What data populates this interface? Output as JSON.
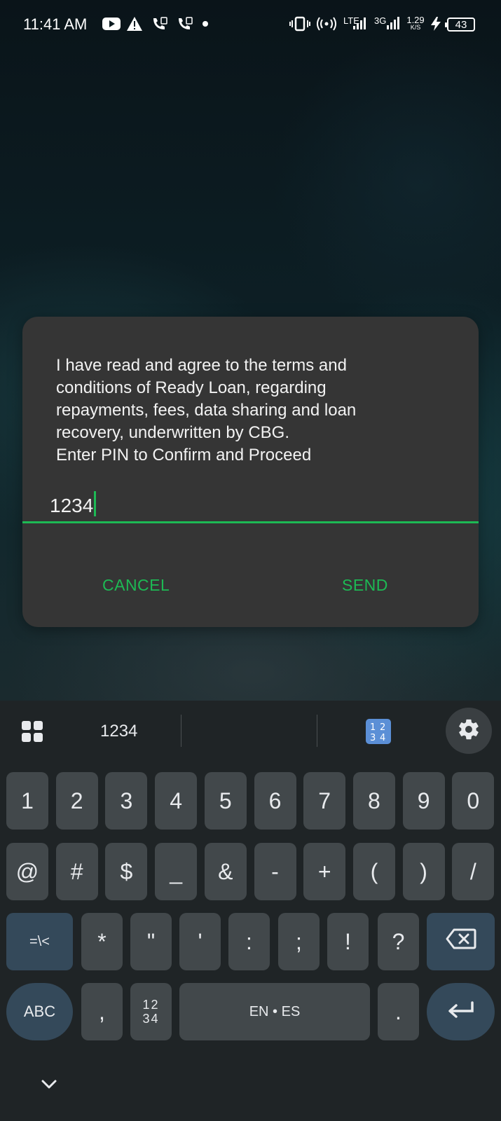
{
  "status_bar": {
    "time": "11:41 AM",
    "network_speed": "1.29",
    "network_speed_unit": "K/S",
    "lte_label": "LTE",
    "g3_label": "3G",
    "battery": "43"
  },
  "dialog": {
    "message": "I have read and agree to the terms and\nconditions of Ready Loan, regarding\nrepayments, fees, data sharing and loan\nrecovery, underwritten by CBG.\nEnter PIN to Confirm and Proceed",
    "pin_value": "1234",
    "cancel_label": "CANCEL",
    "send_label": "SEND",
    "accent": "#1db954"
  },
  "keyboard": {
    "suggestion": "1234",
    "row1": [
      "1",
      "2",
      "3",
      "4",
      "5",
      "6",
      "7",
      "8",
      "9",
      "0"
    ],
    "row2": [
      "@",
      "#",
      "$",
      "_",
      "&",
      "-",
      "+",
      "(",
      ")",
      "/"
    ],
    "row3": [
      "=\\<",
      "*",
      "\"",
      "'",
      ":",
      ";",
      "!",
      "?"
    ],
    "abc_label": "ABC",
    "comma": ",",
    "numpad_label_top": "12",
    "numpad_label_bottom": "34",
    "space_label": "EN • ES",
    "period": "."
  }
}
